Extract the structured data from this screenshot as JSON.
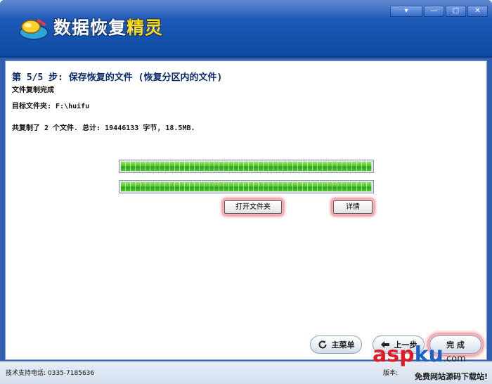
{
  "window": {
    "title_main": "数据恢复",
    "title_accent": "精灵",
    "controls": [
      "▾",
      "—",
      "□",
      "✕"
    ]
  },
  "step": {
    "title": "第 5/5 步: 保存恢复的文件 (恢复分区内的文件)",
    "status": "文件复制完成",
    "target_folder": "目标文件夹: F:\\huifu",
    "summary": "共复制了 2 个文件. 总计: 19446133 字节, 18.5MB."
  },
  "progress": {
    "bar1_fraction": 1.0,
    "bar2_fraction": 1.0
  },
  "buttons": {
    "open_folder": "打开文件夹",
    "details": "详情",
    "main_menu": "主菜单",
    "prev_step": "上一步",
    "finish": "完 成"
  },
  "statusbar": {
    "phone": "技术支持电话: 0335-7185636",
    "version": "版本:"
  },
  "watermark": {
    "red_part": "asp",
    "blue_part": "ku",
    "suffix": ".com",
    "subtitle": "免费网站源码下载站!"
  },
  "colors": {
    "title_bg": "#1a56b4",
    "accent_yellow": "#ffd800",
    "progress_green": "#4fc52d",
    "highlight_red": "#e25c6c"
  }
}
